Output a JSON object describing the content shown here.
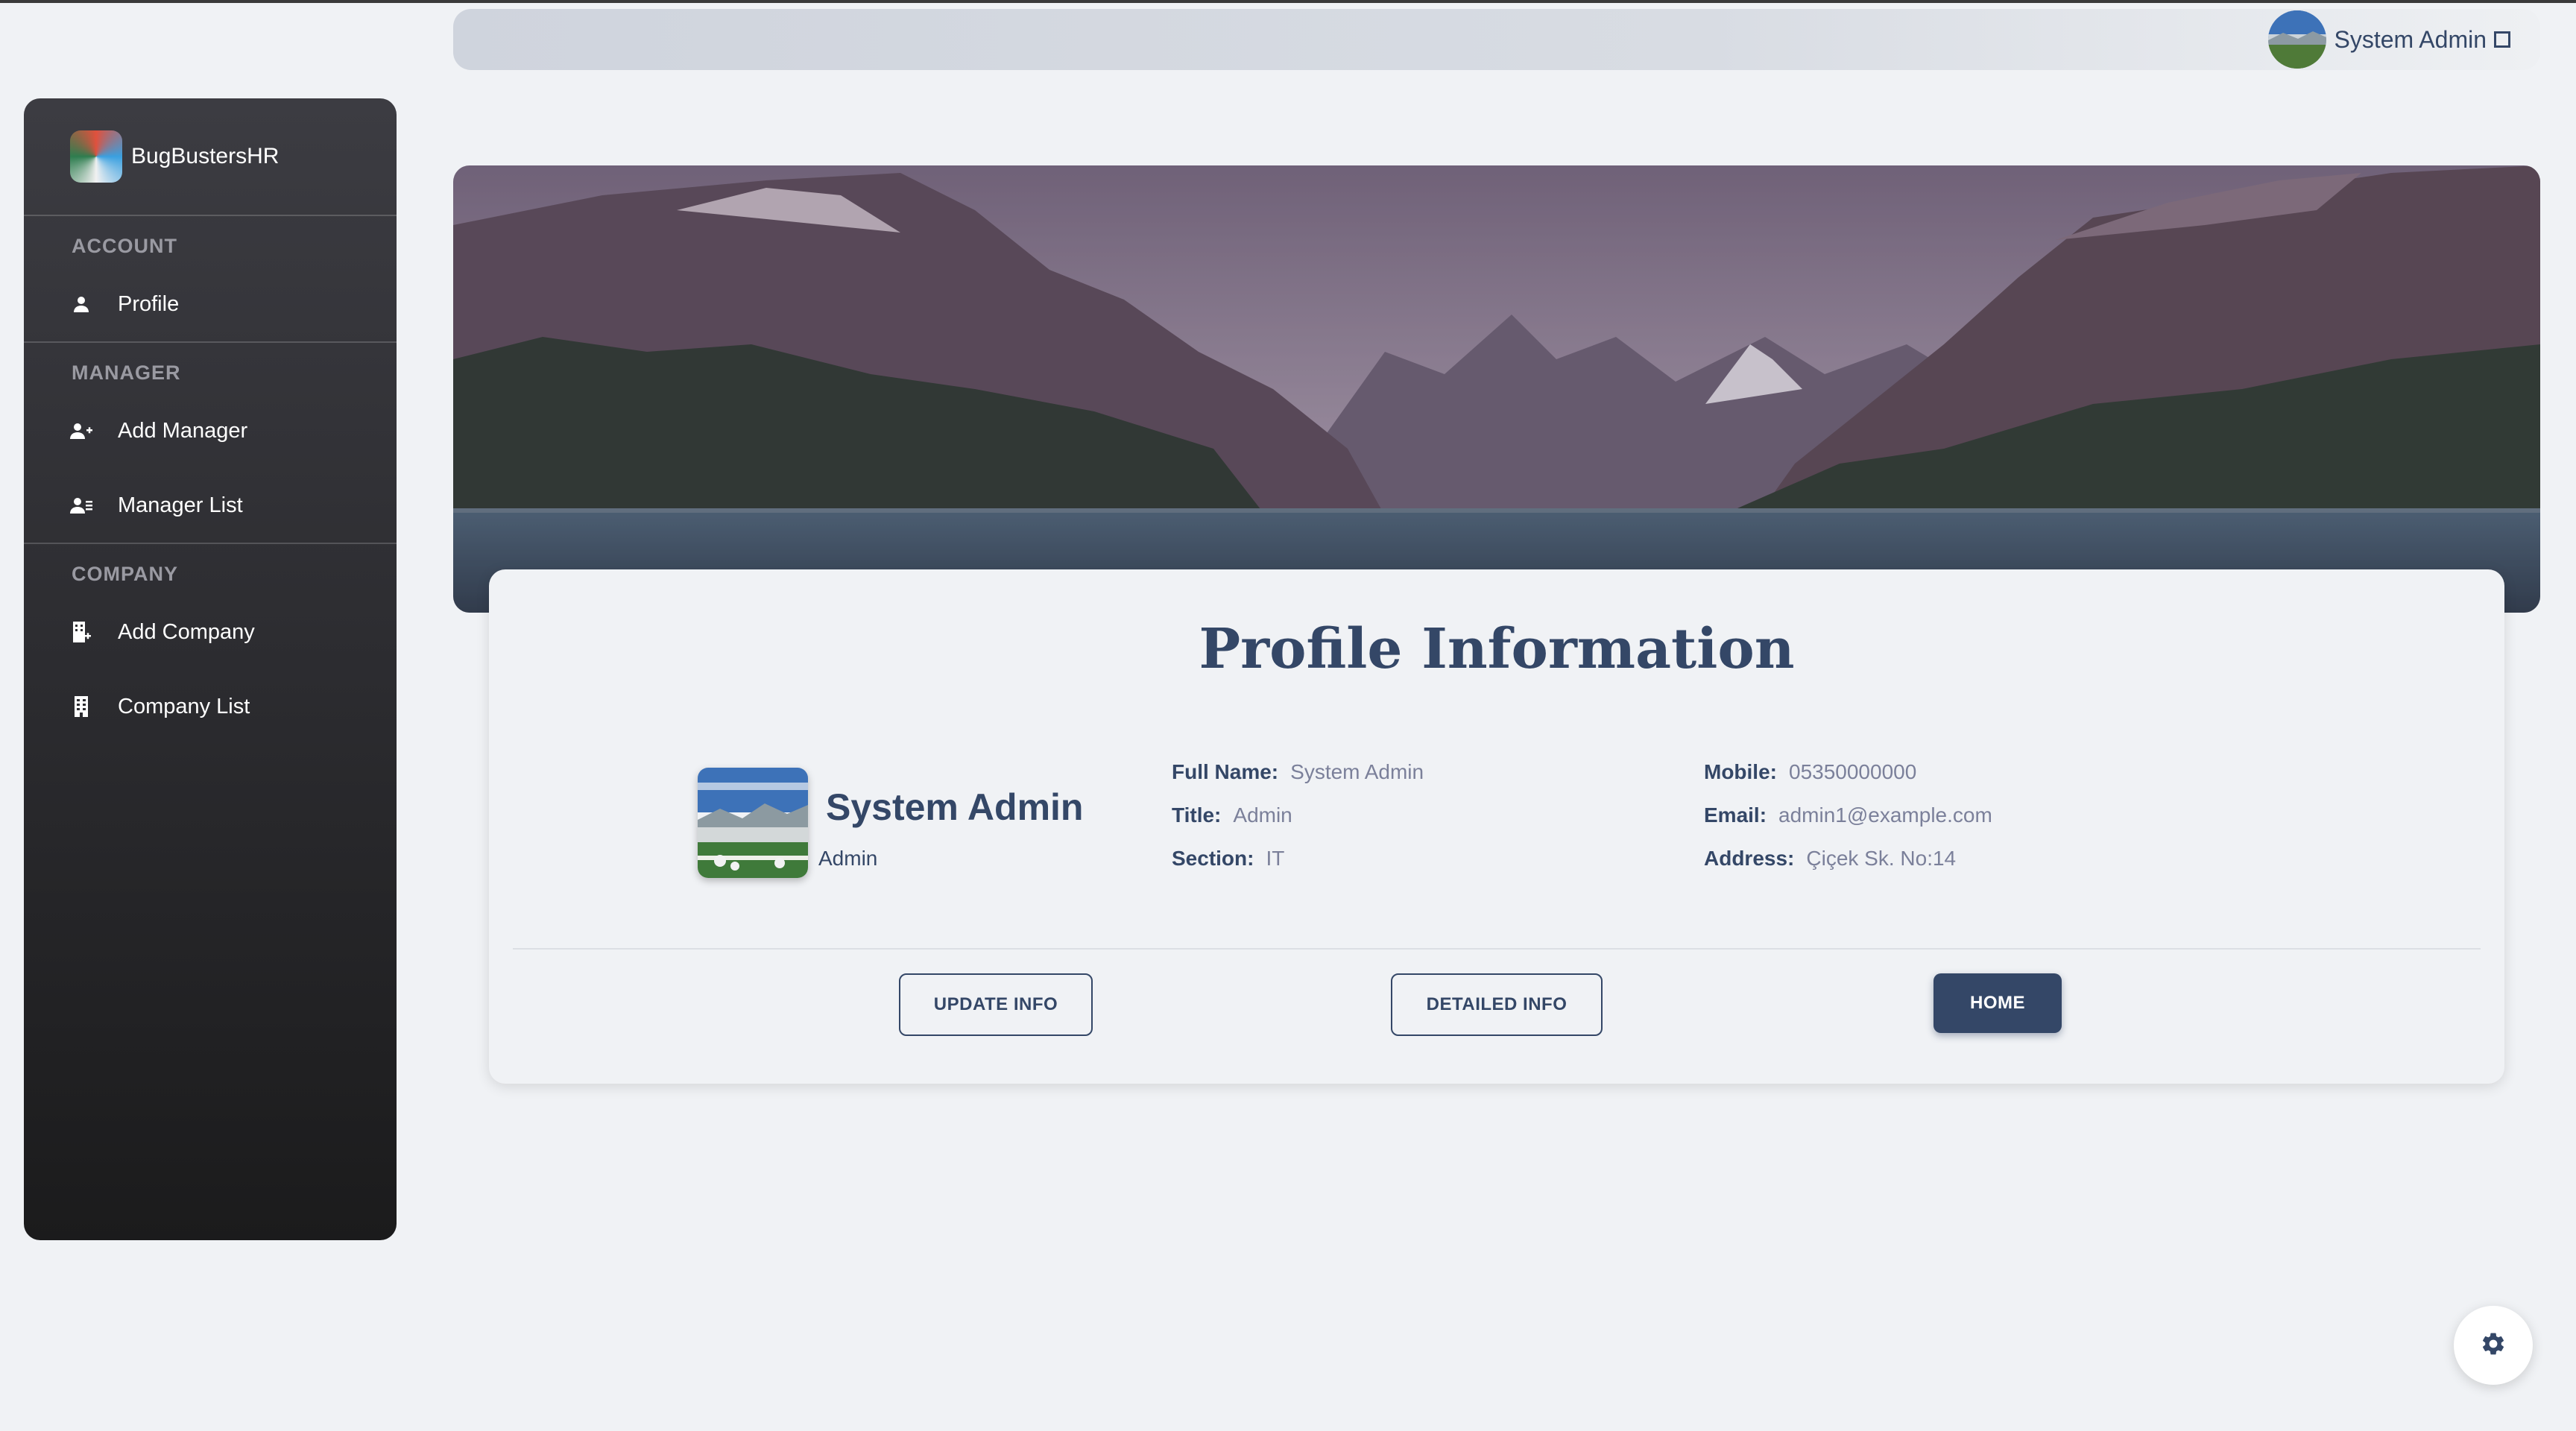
{
  "navbar": {
    "user_name": "System Admin"
  },
  "sidebar": {
    "brand": "BugBustersHR",
    "sections": [
      {
        "title": "ACCOUNT",
        "items": [
          {
            "label": "Profile",
            "icon": "person-icon"
          }
        ]
      },
      {
        "title": "MANAGER",
        "items": [
          {
            "label": "Add Manager",
            "icon": "person-add-icon"
          },
          {
            "label": "Manager List",
            "icon": "person-list-icon"
          }
        ]
      },
      {
        "title": "COMPANY",
        "items": [
          {
            "label": "Add Company",
            "icon": "building-add-icon"
          },
          {
            "label": "Company List",
            "icon": "building-icon"
          }
        ]
      }
    ]
  },
  "profile": {
    "heading": "Profile Information",
    "name": "System Admin",
    "role": "Admin",
    "fields": {
      "full_name": {
        "label": "Full Name:",
        "value": "System Admin"
      },
      "title": {
        "label": "Title:",
        "value": "Admin"
      },
      "section": {
        "label": "Section:",
        "value": "IT"
      },
      "mobile": {
        "label": "Mobile:",
        "value": "05350000000"
      },
      "email": {
        "label": "Email:",
        "value": "admin1@example.com"
      },
      "address": {
        "label": "Address:",
        "value": "Çiçek Sk. No:14"
      }
    },
    "buttons": {
      "update": "UPDATE INFO",
      "detailed": "DETAILED INFO",
      "home": "HOME"
    }
  },
  "colors": {
    "primary": "#344767",
    "muted": "#7b809a",
    "background": "#f0f2f5"
  }
}
